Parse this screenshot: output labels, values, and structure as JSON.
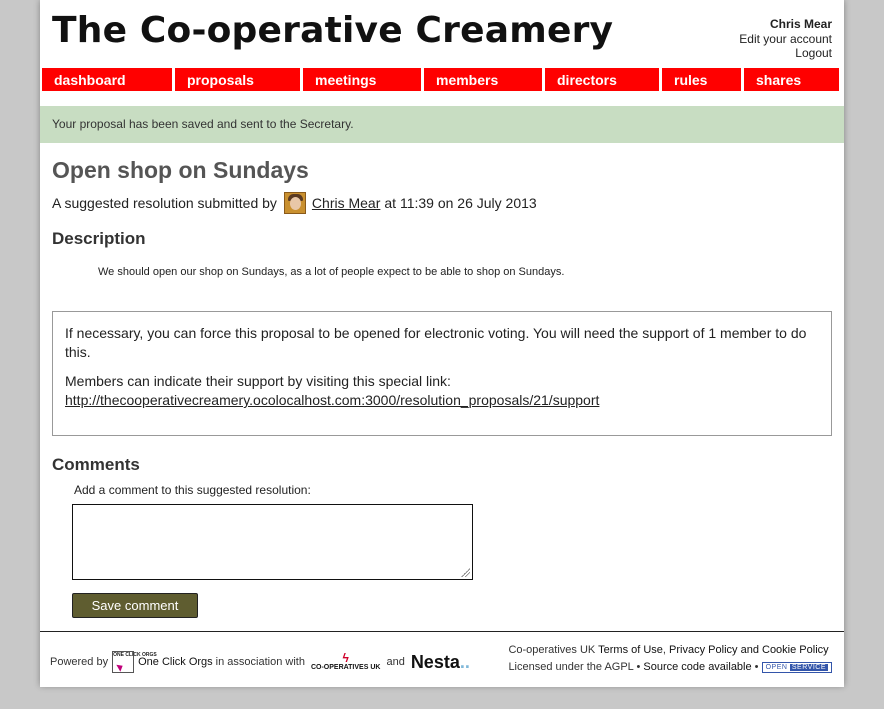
{
  "header": {
    "site_title": "The Co-operative Creamery",
    "user_name": "Chris Mear",
    "edit_account": "Edit your account",
    "logout": "Logout"
  },
  "nav": {
    "items": [
      {
        "label": "dashboard"
      },
      {
        "label": "proposals"
      },
      {
        "label": "meetings"
      },
      {
        "label": "members"
      },
      {
        "label": "directors"
      },
      {
        "label": "rules"
      },
      {
        "label": "shares"
      }
    ],
    "color": "#ff0000"
  },
  "flash": {
    "message": "Your proposal has been saved and sent to the Secretary.",
    "color": "#c8ddc2"
  },
  "proposal": {
    "title": "Open shop on Sundays",
    "byline_prefix": "A suggested resolution submitted by",
    "author": "Chris Mear",
    "byline_suffix": "at 11:39 on 26 July 2013",
    "description_heading": "Description",
    "description": "We should open our shop on Sundays, as a lot of people expect to be able to shop on Sundays."
  },
  "support": {
    "paragraph1": "If necessary, you can force this proposal to be opened for electronic voting. You will need the support of 1 member to do this.",
    "paragraph2": "Members can indicate their support by visiting this special link:",
    "link": "http://thecooperativecreamery.ocolocalhost.com:3000/resolution_proposals/21/support"
  },
  "comments": {
    "heading": "Comments",
    "label": "Add a comment to this suggested resolution:",
    "value": "",
    "save_label": "Save comment",
    "button_color": "#5f5d30"
  },
  "footer": {
    "powered_by": "Powered by",
    "oco_logo_text": "ONE CLICK ORGS",
    "oco_name": "One Click Orgs",
    "association": "in association with",
    "coop_logo_text": "CO-OPERATIVES UK",
    "and": "and",
    "nesta": "Nesta",
    "nesta_dots": "..",
    "coop_uk": "Co-operatives UK",
    "terms": "Terms of Use",
    "privacy": "Privacy Policy",
    "and2": "and",
    "cookie": "Cookie Policy",
    "licensed": "Licensed under the AGPL",
    "source": "Source code available",
    "badge_open": "OPEN",
    "badge_service": "SERVICE"
  }
}
